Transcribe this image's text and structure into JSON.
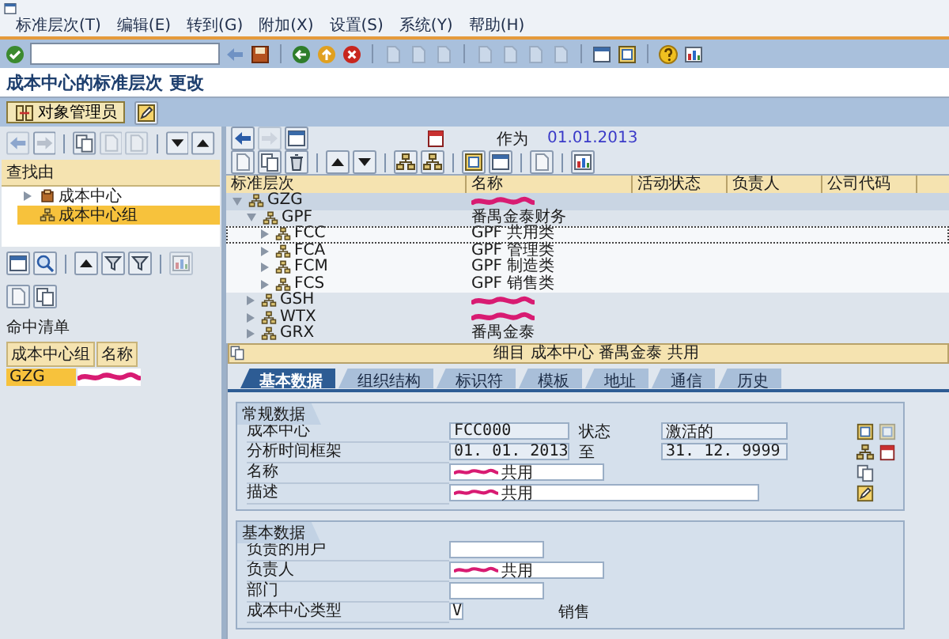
{
  "menu": [
    "标准层次(T)",
    "编辑(E)",
    "转到(G)",
    "附加(X)",
    "设置(S)",
    "系统(Y)",
    "帮助(H)"
  ],
  "title": "成本中心的标准层次 更改",
  "app_toolbar": {
    "button": "对象管理员"
  },
  "left": {
    "search_header": "查找由",
    "search_tree": [
      {
        "label": "成本中心",
        "kind": "folder",
        "selected": false
      },
      {
        "label": "成本中心组",
        "kind": "group",
        "selected": true
      }
    ],
    "hit_list": {
      "title": "命中清单",
      "columns": [
        "成本中心组",
        "名称"
      ],
      "rows": [
        {
          "code": "GZG",
          "name_redacted": true,
          "selected": true
        }
      ]
    }
  },
  "right": {
    "key_date": {
      "label": "作为",
      "value": "01.01.2013"
    },
    "columns": [
      "标准层次",
      "名称",
      "活动状态",
      "负责人",
      "公司代码"
    ],
    "nodes": [
      {
        "code": "GZG",
        "redacted": true,
        "expanded": true,
        "selected": false,
        "children": [
          {
            "code": "GPF",
            "name": "番禺金泰财务",
            "redacted": false,
            "expanded": true,
            "selected": false,
            "children": [
              {
                "code": "FCC",
                "name": "GPF 共用类",
                "redacted": false,
                "expanded": false,
                "selected": true
              },
              {
                "code": "FCA",
                "name": "GPF 管理类",
                "redacted": false,
                "expanded": false,
                "selected": false
              },
              {
                "code": "FCM",
                "name": "GPF 制造类",
                "redacted": false,
                "expanded": false,
                "selected": false
              },
              {
                "code": "FCS",
                "name": "GPF 销售类",
                "redacted": false,
                "expanded": false,
                "selected": false
              }
            ]
          },
          {
            "code": "GSH",
            "redacted": true,
            "expanded": false,
            "selected": false
          },
          {
            "code": "WTX",
            "redacted": true,
            "expanded": false,
            "selected": false
          },
          {
            "code": "GRX",
            "name": "番禺金泰",
            "redacted": false,
            "expanded": false,
            "selected": false
          }
        ]
      }
    ]
  },
  "detail": {
    "header": "细目 成本中心 番禺金泰 共用",
    "tabs": [
      {
        "label": "基本数据",
        "selected": true
      },
      {
        "label": "组织结构",
        "selected": false
      },
      {
        "label": "标识符",
        "selected": false
      },
      {
        "label": "模板",
        "selected": false
      },
      {
        "label": "地址",
        "selected": false
      },
      {
        "label": "通信",
        "selected": false
      },
      {
        "label": "历史",
        "selected": false
      }
    ],
    "groups": [
      {
        "title": "常规数据",
        "rows": [
          {
            "label": "成本中心",
            "value": "FCC000",
            "kind": "readonly",
            "redacted": false,
            "extra_label": "状态",
            "extra_value": "激活的"
          },
          {
            "label": "分析时间框架",
            "value": "01. 01. 2013",
            "kind": "readonly",
            "redacted": false,
            "extra_label": "至",
            "extra_value": "31. 12. 9999"
          },
          {
            "label": "名称",
            "value": "共用",
            "kind": "medium",
            "redacted": true
          },
          {
            "label": "描述",
            "value": "共用",
            "kind": "long",
            "redacted": true
          }
        ]
      },
      {
        "title": "基本数据",
        "rows": [
          {
            "label": "负责的用户",
            "value": "",
            "kind": "short",
            "redacted": false
          },
          {
            "label": "负责人",
            "value": "共用",
            "kind": "medium",
            "redacted": true
          },
          {
            "label": "部门",
            "value": "",
            "kind": "short",
            "redacted": false
          },
          {
            "label": "成本中心类型",
            "value": "V",
            "kind": "tiny",
            "redacted": false,
            "extra_text": "销售"
          }
        ]
      }
    ]
  }
}
